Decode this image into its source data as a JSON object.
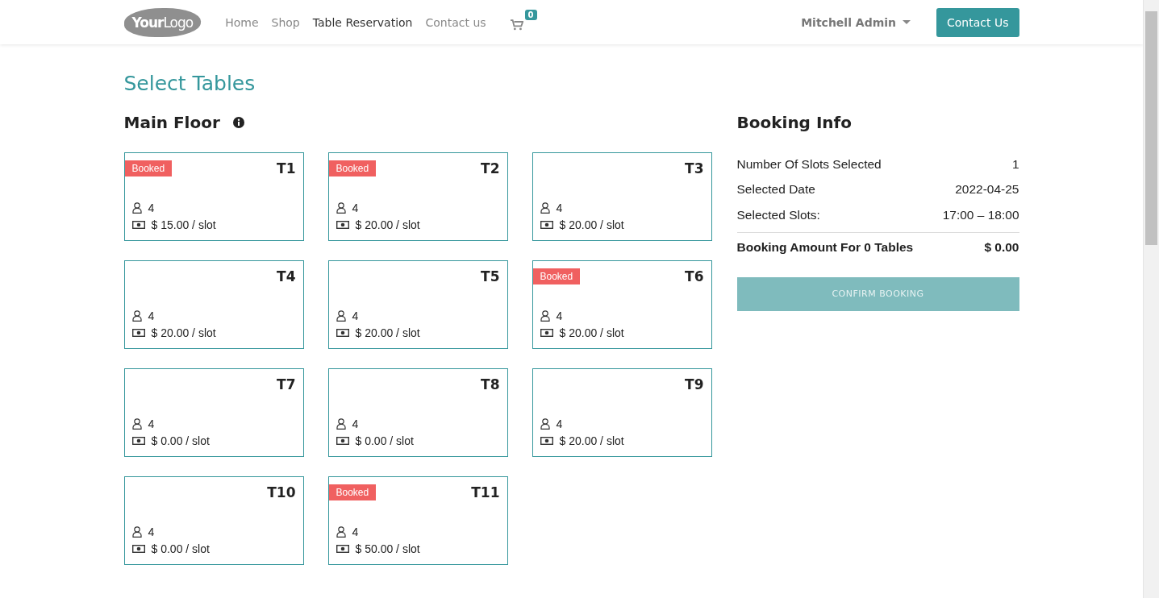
{
  "navbar": {
    "logo": "**Your**Logo",
    "links": [
      {
        "label": "Home",
        "selected": false
      },
      {
        "label": "Shop",
        "selected": false
      },
      {
        "label": "Table Reservation",
        "selected": true
      },
      {
        "label": "Contact us",
        "selected": false
      }
    ],
    "cart_count": "0",
    "user": "Mitchell Admin",
    "contact_button": "Contact Us"
  },
  "page_title": "Select Tables",
  "floor": {
    "name": "Main Floor",
    "tables": [
      {
        "name": "T1",
        "booked": true,
        "badge": "Booked",
        "seats": "4",
        "price": "$ 15.00 / slot"
      },
      {
        "name": "T2",
        "booked": true,
        "badge": "Booked",
        "seats": "4",
        "price": "$ 20.00 / slot"
      },
      {
        "name": "T3",
        "booked": false,
        "seats": "4",
        "price": "$ 20.00 / slot"
      },
      {
        "name": "T4",
        "booked": false,
        "seats": "4",
        "price": "$ 20.00 / slot"
      },
      {
        "name": "T5",
        "booked": false,
        "seats": "4",
        "price": "$ 20.00 / slot"
      },
      {
        "name": "T6",
        "booked": true,
        "badge": "Booked",
        "seats": "4",
        "price": "$ 20.00 / slot"
      },
      {
        "name": "T7",
        "booked": false,
        "seats": "4",
        "price": "$ 0.00 / slot"
      },
      {
        "name": "T8",
        "booked": false,
        "seats": "4",
        "price": "$ 0.00 / slot"
      },
      {
        "name": "T9",
        "booked": false,
        "seats": "4",
        "price": "$ 20.00 / slot"
      },
      {
        "name": "T10",
        "booked": false,
        "seats": "4",
        "price": "$ 0.00 / slot"
      },
      {
        "name": "T11",
        "booked": true,
        "badge": "Booked",
        "seats": "4",
        "price": "$ 50.00 / slot"
      }
    ]
  },
  "booking_info": {
    "title": "Booking Info",
    "rows": [
      {
        "label": "Number Of Slots Selected",
        "value": "1"
      },
      {
        "label": "Selected Date",
        "value": "2022-04-25"
      },
      {
        "label": "Selected Slots:",
        "value": "17:00 – 18:00"
      }
    ],
    "total": {
      "label": "Booking Amount For 0 Tables",
      "value": "$ 0.00"
    },
    "confirm_button": {
      "label": "CONFIRM BOOKING",
      "disabled": true
    }
  }
}
